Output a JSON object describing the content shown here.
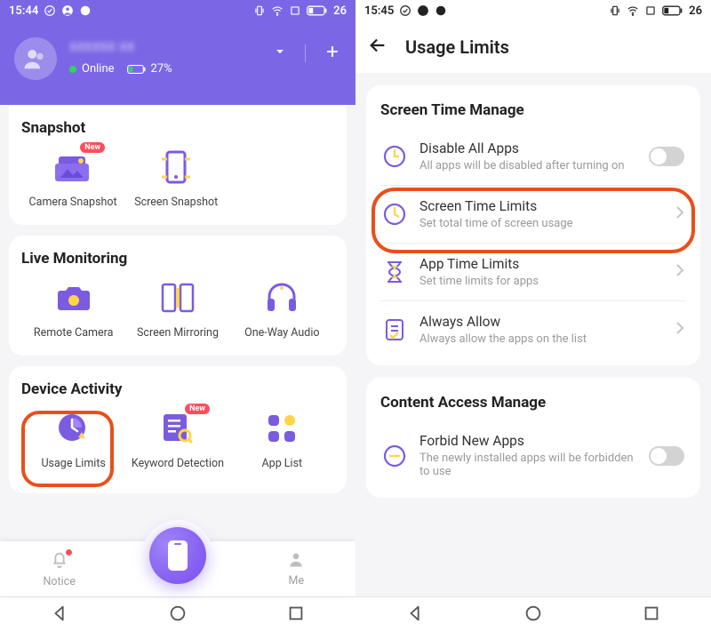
{
  "left": {
    "status": {
      "time": "15:44",
      "battery": "26"
    },
    "device": {
      "name": "xxxxxx xx",
      "status": "Online",
      "batteryPct": "27%"
    },
    "sections": {
      "snapshot": {
        "title": "Snapshot",
        "items": [
          {
            "label": "Camera Snapshot",
            "badge": "New"
          },
          {
            "label": "Screen Snapshot"
          }
        ]
      },
      "live": {
        "title": "Live Monitoring",
        "items": [
          {
            "label": "Remote Camera"
          },
          {
            "label": "Screen Mirroring"
          },
          {
            "label": "One-Way Audio"
          }
        ]
      },
      "activity": {
        "title": "Device Activity",
        "items": [
          {
            "label": "Usage Limits"
          },
          {
            "label": "Keyword Detection",
            "badge": "New"
          },
          {
            "label": "App List"
          }
        ]
      }
    },
    "tabs": {
      "notice": "Notice",
      "device": "Device",
      "me": "Me"
    }
  },
  "right": {
    "status": {
      "time": "15:45",
      "battery": "26"
    },
    "title": "Usage Limits",
    "screenTime": {
      "heading": "Screen Time Manage",
      "rows": [
        {
          "title": "Disable All Apps",
          "sub": "All apps will be disabled after turning on"
        },
        {
          "title": "Screen Time Limits",
          "sub": "Set total time of screen usage"
        },
        {
          "title": "App Time Limits",
          "sub": "Set time limits for apps"
        },
        {
          "title": "Always Allow",
          "sub": "Always allow the apps on the list"
        }
      ]
    },
    "content": {
      "heading": "Content Access Manage",
      "rows": [
        {
          "title": "Forbid New Apps",
          "sub": "The newly installed apps will be forbidden to use"
        }
      ]
    }
  }
}
